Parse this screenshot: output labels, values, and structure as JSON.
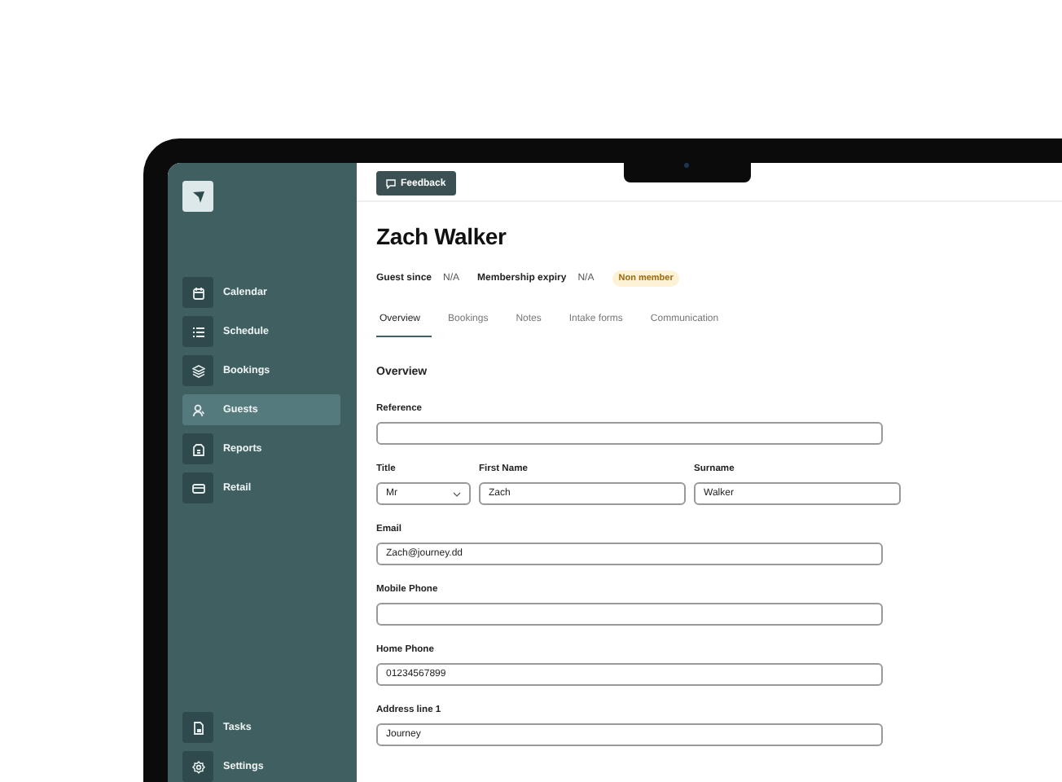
{
  "sidebar": {
    "items": [
      {
        "label": "Calendar",
        "selected": false
      },
      {
        "label": "Schedule",
        "selected": false
      },
      {
        "label": "Bookings",
        "selected": false
      },
      {
        "label": "Guests",
        "selected": true
      },
      {
        "label": "Reports",
        "selected": false
      },
      {
        "label": "Retail",
        "selected": false
      }
    ],
    "bottom_items": [
      {
        "label": "Tasks",
        "selected": false
      },
      {
        "label": "Settings",
        "selected": false
      }
    ]
  },
  "feedback_button": "Feedback",
  "guest_name": "Zach Walker",
  "meta": [
    {
      "label": "Guest since",
      "value": "N/A"
    },
    {
      "label": "Membership expiry",
      "value": "N/A"
    }
  ],
  "badge": "Non member",
  "tabs": [
    {
      "label": "Overview",
      "selected": true
    },
    {
      "label": "Bookings",
      "selected": false
    },
    {
      "label": "Notes",
      "selected": false
    },
    {
      "label": "Intake forms",
      "selected": false
    },
    {
      "label": "Communication",
      "selected": false
    }
  ],
  "section_title": "Overview",
  "fields": [
    {
      "label": "Reference"
    },
    {
      "row": [
        {
          "label": "Title",
          "value": "Mr",
          "kind": "select"
        },
        {
          "label": "First Name",
          "value": "Zach",
          "kind": "text"
        },
        {
          "label": "Surname",
          "value": "Walker",
          "kind": "text"
        }
      ]
    },
    {
      "label": "Email",
      "value": "Zach@journey.dd"
    },
    {
      "label": "Mobile Phone"
    },
    {
      "label": "Home Phone",
      "value": "01234567899"
    },
    {
      "label": "Address line 1",
      "value": "Journey"
    }
  ]
}
